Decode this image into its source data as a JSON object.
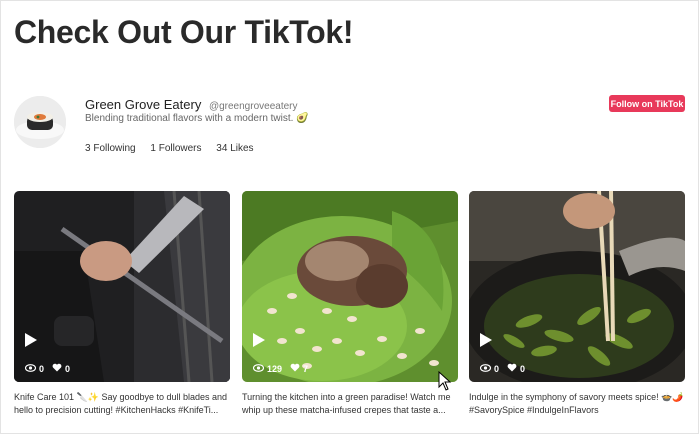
{
  "page": {
    "title": "Check Out Our TikTok!"
  },
  "profile": {
    "name": "Green Grove Eatery",
    "handle": "@greengroveeatery",
    "bio": "Blending traditional flavors with a modern twist. 🥑",
    "following": "3 Following",
    "followers": "1 Followers",
    "likes": "34 Likes",
    "follow_button": "Follow on TikTok"
  },
  "videos": [
    {
      "views": "0",
      "likes": "0",
      "caption": "Knife Care 101 🔪✨ Say goodbye to dull blades and hello to precision cutting! #KitchenHacks #KnifeTi..."
    },
    {
      "views": "129",
      "likes": "7",
      "caption": "Turning the kitchen into a green paradise! Watch me whip up these matcha-infused crepes that taste a..."
    },
    {
      "views": "0",
      "likes": "0",
      "caption": "Indulge in the symphony of savory meets spice! 🍲🌶️ #SavorySpice #IndulgeInFlavors"
    }
  ],
  "colors": {
    "accent": "#e8395a"
  }
}
